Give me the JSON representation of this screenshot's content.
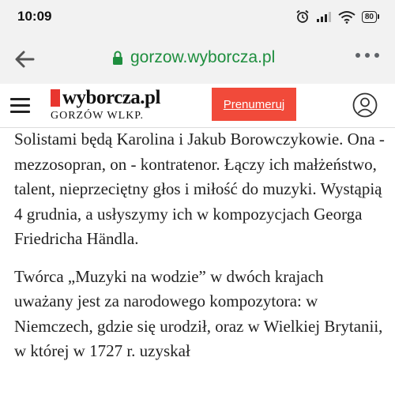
{
  "status_bar": {
    "time": "10:09",
    "battery": "80",
    "icons": [
      "alarm-icon",
      "signal-icon",
      "wifi-icon",
      "battery-icon"
    ]
  },
  "browser": {
    "url": "gorzow.wyborcza.pl",
    "url_color": "#1e8e3e",
    "icons": [
      "back-arrow-icon",
      "lock-icon",
      "more-options-icon"
    ]
  },
  "site_header": {
    "logo_text": "wyborcza.pl",
    "logo_city": "GORZÓW WLKP.",
    "subscribe_label": "Prenumeruj",
    "subscribe_color": "#f14a3a",
    "logo_accent_color": "#e8362f",
    "icons": [
      "menu-icon",
      "user-icon"
    ]
  },
  "article": {
    "paragraphs": [
      "Solistami będą Karolina i Jakub Borowczykowie. Ona - mezzosopran, on - kontratenor. Łączy ich małżeństwo, talent, nieprzeciętny głos i miłość do muzyki. Wystąpią 4 grudnia, a usłyszymy ich w kompozycjach Georga Friedricha Händla.",
      "Twórca „Muzyki na wodzie” w dwóch krajach uważany jest za narodowego kompozytora: w Niemczech, gdzie się urodził, oraz w Wielkiej Brytanii, w której w 1727 r. uzyskał"
    ]
  }
}
